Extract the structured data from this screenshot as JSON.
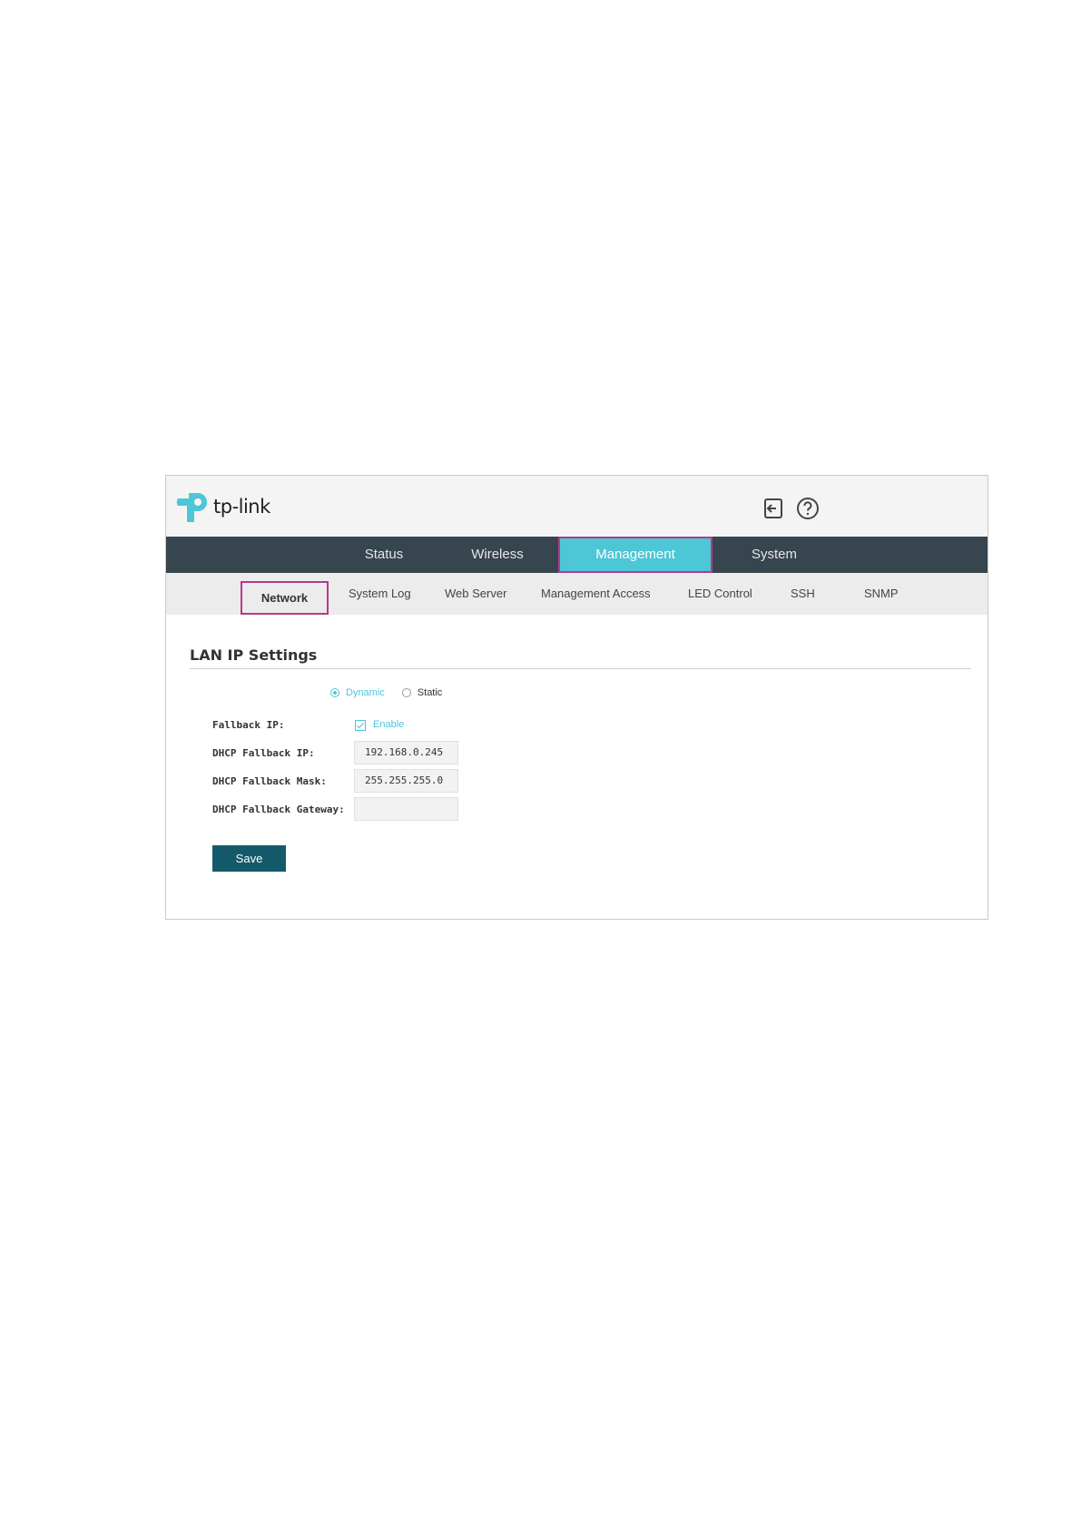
{
  "header": {
    "logo_text": "tp-link",
    "logout_icon": "logout-icon",
    "help_icon": "help-icon"
  },
  "main_nav": [
    {
      "label": "Status"
    },
    {
      "label": "Wireless"
    },
    {
      "label": "Management",
      "active": true
    },
    {
      "label": "System"
    }
  ],
  "sub_nav": [
    {
      "label": "Network",
      "active": true
    },
    {
      "label": "System Log"
    },
    {
      "label": "Web Server"
    },
    {
      "label": "Management Access"
    },
    {
      "label": "LED Control"
    },
    {
      "label": "SSH"
    },
    {
      "label": "SNMP"
    }
  ],
  "section": {
    "title": "LAN IP Settings",
    "mode_options": [
      {
        "label": "Dynamic",
        "selected": true
      },
      {
        "label": "Static",
        "selected": false
      }
    ],
    "fallback_ip": {
      "label": "Fallback IP:",
      "checkbox_label": "Enable",
      "checked": true
    },
    "dhcp_fallback_ip": {
      "label": "DHCP Fallback IP:",
      "value": "192.168.0.245"
    },
    "dhcp_fallback_mask": {
      "label": "DHCP Fallback Mask:",
      "value": "255.255.255.0"
    },
    "dhcp_fallback_gateway": {
      "label": "DHCP Fallback Gateway:",
      "value": ""
    },
    "save_label": "Save"
  },
  "colors": {
    "accent": "#4dc6d6",
    "nav_bg": "#37454f",
    "highlight_border": "#b5398e",
    "save_bg": "#145a6a"
  }
}
